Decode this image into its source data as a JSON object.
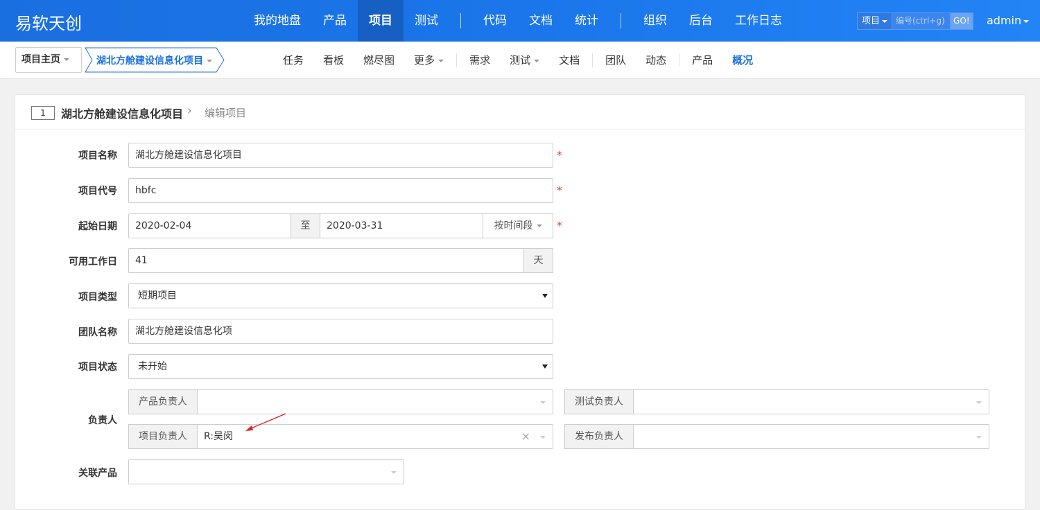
{
  "header": {
    "brand": "易软天创",
    "nav": [
      "我的地盘",
      "产品",
      "项目",
      "测试",
      "代码",
      "文档",
      "统计",
      "组织",
      "后台",
      "工作日志"
    ],
    "active_nav": "项目",
    "search_type": "项目",
    "search_placeholder": "编号(ctrl+g)",
    "go_label": "GO!",
    "user": "admin"
  },
  "subnav": {
    "crumb_home": "项目主页",
    "crumb_project": "湖北方舱建设信息化项目",
    "items": [
      "任务",
      "看板",
      "燃尽图",
      "更多",
      "需求",
      "测试",
      "文档",
      "团队",
      "动态",
      "产品",
      "概况"
    ],
    "active_item": "概况"
  },
  "panel": {
    "id": "1",
    "title": "湖北方舱建设信息化项目",
    "subtitle": "编辑项目"
  },
  "form": {
    "name_label": "项目名称",
    "name_value": "湖北方舱建设信息化项目",
    "code_label": "项目代号",
    "code_value": "hbfc",
    "date_label": "起始日期",
    "begin": "2020-02-04",
    "to_label": "至",
    "end": "2020-03-31",
    "period_label": "按时间段",
    "days_label": "可用工作日",
    "days_value": "41",
    "days_unit": "天",
    "type_label": "项目类型",
    "type_value": "短期项目",
    "team_label": "团队名称",
    "team_value": "湖北方舱建设信息化项",
    "status_label": "项目状态",
    "status_value": "未开始",
    "owner_label": "负责人",
    "po_label": "产品负责人",
    "po_value": "",
    "qd_label": "测试负责人",
    "qd_value": "",
    "pm_label": "项目负责人",
    "pm_value": "R:吴闵",
    "rd_label": "发布负责人",
    "rd_value": "",
    "products_label": "关联产品",
    "required_mark": "*"
  },
  "colors": {
    "header_blue": "#1a6fe0",
    "active_blue": "#1a6fe0",
    "required_red": "#e4393c",
    "arrow_red": "#e02020"
  }
}
